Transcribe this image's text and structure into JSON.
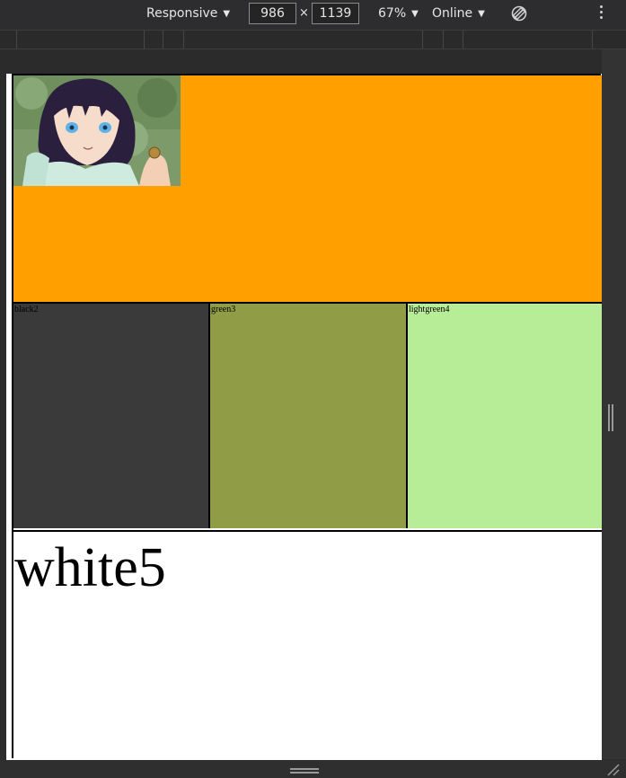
{
  "toolbar": {
    "device_mode": "Responsive",
    "width_value": "986",
    "height_value": "1139",
    "times_symbol": "×",
    "zoom": "67%",
    "throttling": "Online"
  },
  "page": {
    "cells": [
      {
        "label": "black2",
        "color": "#3a3a3a"
      },
      {
        "label": "green3",
        "color": "#909c46"
      },
      {
        "label": "lightgreen4",
        "color": "#b6ed96"
      }
    ],
    "orange_color": "#ffa000",
    "white_label": "white5"
  }
}
